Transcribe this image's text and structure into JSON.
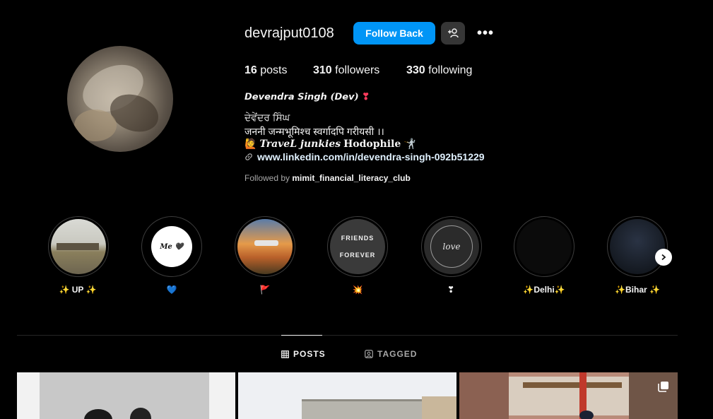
{
  "profile": {
    "username": "devrajput0108",
    "follow_back_label": "Follow Back",
    "more_label": "•••",
    "stats": {
      "posts_count": "16",
      "posts_label": "posts",
      "followers_count": "310",
      "followers_label": "followers",
      "following_count": "330",
      "following_label": "following"
    },
    "display_name": "𝘿𝙚𝙫𝙚𝙣𝙙𝙧𝙖 𝙎𝙞𝙣𝙜𝙝 (𝘿𝙚𝙫)",
    "name_emoji": "❣",
    "bio_line1": "ਦੇਵੇਂਦਰ ਸਿੰਘ",
    "bio_line2": "जननी जन्मभूमिश्च स्वर्गादपि गरीयसी ।।",
    "bio_line3_emoji": "🙋",
    "bio_line3_italic": "TraveL junkies",
    "bio_line3_bold": "Hodophile",
    "bio_line3_end_emoji": "🤺",
    "link": "www.linkedin.com/in/devendra-singh-092b51229",
    "followed_by_prefix": "Followed by",
    "followed_by_user": "mimit_financial_literacy_club"
  },
  "highlights": [
    {
      "label": "✨ UP ✨"
    },
    {
      "label": "💙",
      "inner_text": "Me 🖤"
    },
    {
      "label": "🚩"
    },
    {
      "label": "💥",
      "inner_text_top": "FRIENDS",
      "inner_text_bottom": "FOREVER"
    },
    {
      "label": "❣",
      "inner_text": "love"
    },
    {
      "label": "✨Delhi✨"
    },
    {
      "label": "✨Bihar ✨"
    }
  ],
  "tabs": {
    "posts_label": "POSTS",
    "tagged_label": "TAGGED"
  },
  "colors": {
    "accent": "#0095f6",
    "background": "#000000",
    "secondary_text": "#a8a8a8"
  }
}
